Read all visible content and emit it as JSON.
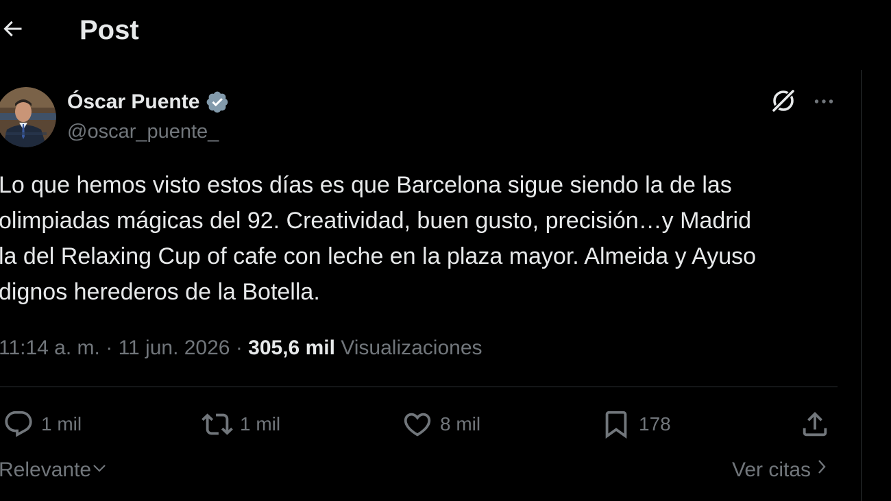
{
  "header": {
    "title": "Post"
  },
  "author": {
    "name": "Óscar Puente",
    "handle": "@oscar_puente_",
    "verified": true
  },
  "tweet": {
    "text": "Lo que hemos visto estos días es que Barcelona sigue siendo la de las\nolimpiadas mágicas del 92. Creatividad, buen gusto, precisión…y Madrid\nla del Relaxing Cup of cafe con leche en la plaza mayor. Almeida y Ayuso\ndignos herederos de la Botella."
  },
  "meta": {
    "time": "11:14 a. m.",
    "separator": "·",
    "date": "11 jun. 2026",
    "views_count": "305,6 mil",
    "views_label": "Visualizaciones"
  },
  "actions": {
    "replies": "1 mil",
    "reposts": "1 mil",
    "likes": "8 mil",
    "bookmarks": "178"
  },
  "footer": {
    "sort_label": "Relevante",
    "quotes_label": "Ver citas"
  },
  "colors": {
    "background": "#000000",
    "text_primary": "#e7e9ea",
    "text_secondary": "#71767b",
    "divider": "#2f3336",
    "verified": "#829aab"
  },
  "icons": {
    "back": "arrow-left-icon",
    "verified": "verified-badge-icon",
    "grok": "grok-icon",
    "more": "more-horizontal-icon",
    "reply": "reply-icon",
    "repost": "repost-icon",
    "like": "heart-icon",
    "bookmark": "bookmark-icon",
    "share": "share-icon",
    "sort": "chevron-down-icon",
    "quotes": "chevron-right-icon"
  }
}
